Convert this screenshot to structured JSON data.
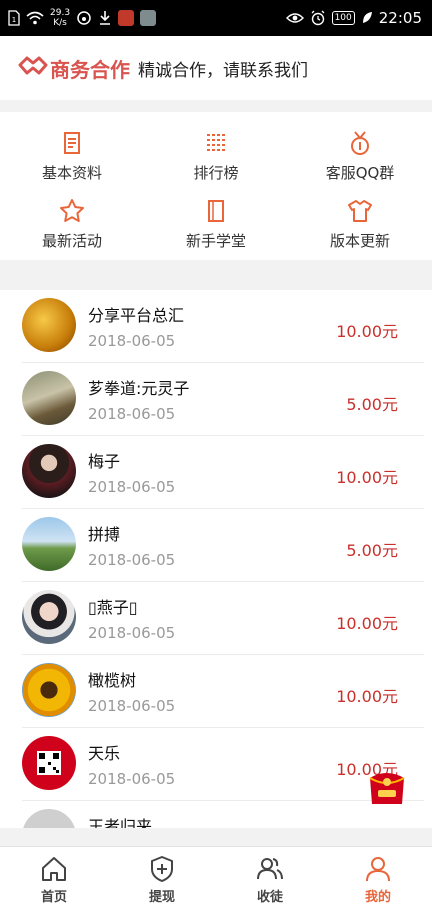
{
  "status_bar": {
    "network_speed_value": "29.3",
    "network_speed_unit": "K/s",
    "battery": "100",
    "time": "22:05"
  },
  "banner": {
    "logo_text": "商务合作",
    "slogan": "精诚合作，请联系我们"
  },
  "colors": {
    "accent": "#e8663a",
    "amount": "#c9302c",
    "logo": "#d9534f"
  },
  "quick_menu": [
    {
      "label": "基本资料",
      "icon": "document-icon"
    },
    {
      "label": "排行榜",
      "icon": "ranking-list-icon"
    },
    {
      "label": "客服QQ群",
      "icon": "medal-icon"
    },
    {
      "label": "最新活动",
      "icon": "star-icon"
    },
    {
      "label": "新手学堂",
      "icon": "book-icon"
    },
    {
      "label": "版本更新",
      "icon": "tshirt-icon"
    }
  ],
  "records": [
    {
      "name": "分享平台总汇",
      "date": "2018-06-05",
      "amount": "10.00元"
    },
    {
      "name": "芗拳道:元灵子",
      "date": "2018-06-05",
      "amount": "5.00元"
    },
    {
      "name": "梅子",
      "date": "2018-06-05",
      "amount": "10.00元"
    },
    {
      "name": "拼搏",
      "date": "2018-06-05",
      "amount": "5.00元"
    },
    {
      "name": "▯燕子▯",
      "date": "2018-06-05",
      "amount": "10.00元"
    },
    {
      "name": "橄榄树",
      "date": "2018-06-05",
      "amount": "10.00元"
    },
    {
      "name": "天乐",
      "date": "2018-06-05",
      "amount": "10.00元"
    },
    {
      "name": "王者归来",
      "date": "",
      "amount": ""
    }
  ],
  "tabs": [
    {
      "label": "首页",
      "icon": "home-icon"
    },
    {
      "label": "提现",
      "icon": "shield-plus-icon"
    },
    {
      "label": "收徒",
      "icon": "users-icon"
    },
    {
      "label": "我的",
      "icon": "user-icon",
      "active": true
    }
  ]
}
